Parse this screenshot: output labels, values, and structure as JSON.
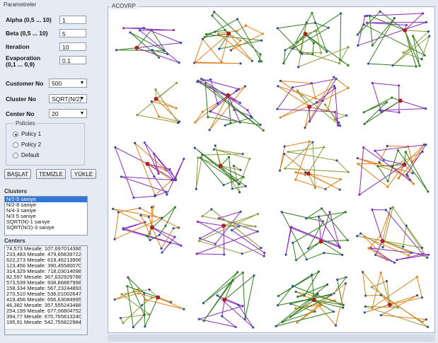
{
  "left": {
    "params_title": "Parametreler",
    "alpha": {
      "label": "Alpha (0,5 ... 10)",
      "value": "1"
    },
    "beta": {
      "label": "Beta (0,5 ... 10)",
      "value": "5"
    },
    "iteration": {
      "label": "Iteration",
      "value": "10"
    },
    "evaporation": {
      "label": "Evaporation\n(0,1 ... 0,9)",
      "label1": "Evaporation",
      "label2": "(0,1 ... 0,9)",
      "value": "0.1"
    },
    "customer": {
      "label": "Customer No",
      "value": "500"
    },
    "cluster": {
      "label": "Cluster No",
      "value": "SQRT(N/2)"
    },
    "center": {
      "label": "Center No",
      "value": "20"
    },
    "policies": {
      "title": "Policies",
      "items": [
        "Policy 1",
        "Policy 2",
        "Default"
      ],
      "selected": 0
    },
    "buttons": {
      "baslat": "BAŞLAT",
      "temizle": "TEMİZLE",
      "yukle": "YÜKLE"
    },
    "clusters": {
      "title": "Clusters",
      "items": [
        "N/2-5 saniye",
        "N/2-8 saniye",
        "N/4-3 saniye",
        "N/3 5 saniye",
        "SQRT(N)-1 saniye",
        "SQRT(N/2)-3 saniye"
      ],
      "selected": 0
    },
    "centers": {
      "title": "Centers",
      "items": [
        "74,573 Mesafe: 107,697014386",
        "233,483 Mesafe: 479,658397225",
        "622,273 Mesafe: 619,4621390620",
        "123,456 Mesafe: 390,45580070",
        "314,329 Mesafe: 718,030140985",
        "82,597 Mesafe: 367,6329297880",
        "573,539 Mesafe: 938,8688799880",
        "158,334 Mesafe: 567,232448938",
        "270,510 Mesafe: 536,010026470",
        "419,456 Mesafe: 656,630849954",
        "46,382 Mesafe: 357,5552434880",
        "254,199 Mesafe: 677,068047520",
        "394,77 Mesafe: 670,765813240",
        "195,91 Mesafe: 542,7558229840"
      ]
    }
  },
  "canvas": {
    "title": "ACOVRP",
    "colors": {
      "green": "#2e7d1e",
      "olive": "#8b9a3a",
      "purple": "#8a2bb5",
      "orange": "#e0801a",
      "depot": "#b02020",
      "node": "#2b4fa3"
    }
  }
}
